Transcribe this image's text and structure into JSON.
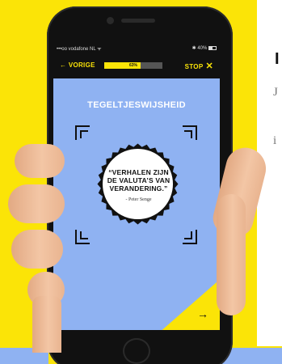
{
  "status_bar": {
    "carrier": "•••oo vodafone NL ᯤ",
    "time": "",
    "battery": "✱ 40%"
  },
  "nav": {
    "prev_label": "← VORIGE",
    "stop_label": "STOP",
    "stop_icon": "close-icon",
    "progress_percent": 63,
    "progress_text": "63%"
  },
  "content": {
    "title": "TEGELTJESWIJSHEID",
    "quote": "“VERHALEN ZIJN DE VALUTA’S VAN VERANDERING.”",
    "author": "- Peter Senge",
    "next_icon": "arrow-right-icon",
    "next_symbol": "→"
  },
  "side": {
    "heading": "I",
    "line1": "J",
    "line2": "i"
  },
  "colors": {
    "background": "#fbe407",
    "screen": "#8fb2f2",
    "accent": "#fbe407"
  }
}
